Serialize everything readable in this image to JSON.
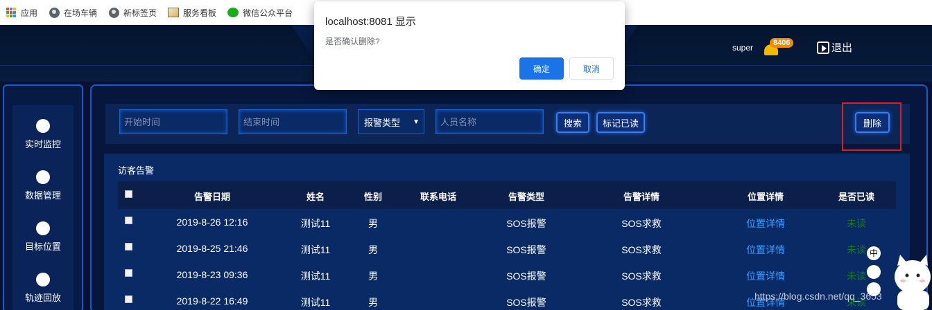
{
  "bookmarks": [
    {
      "label": "应用",
      "icon": "apps-grid-icon"
    },
    {
      "label": "在场车辆",
      "icon": "globe-icon"
    },
    {
      "label": "新标签页",
      "icon": "globe-icon"
    },
    {
      "label": "服务看板",
      "icon": "board-icon"
    },
    {
      "label": "微信公众平台",
      "icon": "wechat-icon"
    }
  ],
  "header": {
    "username": "super",
    "notification_count": "8406",
    "logout_label": "退出"
  },
  "sidebar": {
    "items": [
      {
        "label": "实时监控",
        "icon": "dashboard-gauge-icon"
      },
      {
        "label": "数据管理",
        "icon": "pie-chart-icon"
      },
      {
        "label": "目标位置",
        "icon": "map-pin-icon"
      },
      {
        "label": "轨迹回放",
        "icon": "track-replay-icon"
      }
    ]
  },
  "toolbar": {
    "start_time_placeholder": "开始时间",
    "end_time_placeholder": "结束时间",
    "alarm_type_selected": "报警类型",
    "person_name_placeholder": "人员名称",
    "search_label": "搜索",
    "mark_read_label": "标记已读",
    "delete_label": "删除"
  },
  "table": {
    "section_title": "访客告警",
    "columns": [
      "告警日期",
      "姓名",
      "性别",
      "联系电话",
      "告警类型",
      "告警详情",
      "位置详情",
      "是否已读"
    ],
    "rows": [
      {
        "date": "2019-8-26 12:16",
        "name": "测试11",
        "gender": "男",
        "phone": "",
        "type": "SOS报警",
        "detail": "SOS求救",
        "location": "位置详情",
        "read": "未读"
      },
      {
        "date": "2019-8-25 21:46",
        "name": "测试11",
        "gender": "男",
        "phone": "",
        "type": "SOS报警",
        "detail": "SOS求救",
        "location": "位置详情",
        "read": "未读"
      },
      {
        "date": "2019-8-23 09:36",
        "name": "测试11",
        "gender": "男",
        "phone": "",
        "type": "SOS报警",
        "detail": "SOS求救",
        "location": "位置详情",
        "read": "未读"
      },
      {
        "date": "2019-8-22 16:49",
        "name": "测试11",
        "gender": "男",
        "phone": "",
        "type": "SOS报警",
        "detail": "SOS求救",
        "location": "位置详情",
        "read": "未读"
      }
    ]
  },
  "dialog": {
    "title": "localhost:8081 显示",
    "message": "是否确认删除?",
    "ok_label": "确定",
    "cancel_label": "取消"
  },
  "floating": {
    "ime_label": "中"
  },
  "watermark": "https://blog.csdn.net/qq_3653",
  "colors": {
    "accent": "#1a73e8",
    "panel_border": "#1a5ad6",
    "link": "#3ba0ff",
    "unread": "#157a2a",
    "highlight_box": "#e02020"
  }
}
